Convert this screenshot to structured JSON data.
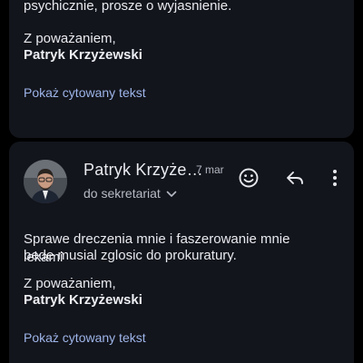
{
  "previous_message": {
    "body_fragment": "psychicznie, prosze o wyjasnienie.",
    "signoff": "Z poważaniem,",
    "signature": "Patryk Krzyżewski",
    "show_quoted_text": "Pokaż cytowany tekst"
  },
  "message": {
    "sender_name": "Patryk Krzyże…",
    "date": "7 mar",
    "recipient": "do sekretariat",
    "body_line_1": "Sprawe dreczenia mnie i faszerowanie mnie lekami",
    "body_line_2": "bede musial zglosic do prokuratury.",
    "signoff": "Z poważaniem,",
    "signature": "Patryk Krzyżewski",
    "show_quoted_text": "Pokaż cytowany tekst"
  },
  "icons": {
    "emoji": "smiley-icon",
    "reply": "reply-icon",
    "more": "more-vert-icon",
    "chevron": "chevron-down-icon"
  },
  "colors": {
    "background": "#000000",
    "card": "#13151c",
    "text": "#e8eaf0",
    "link": "#9db4e8",
    "secondary": "#b6bac4"
  }
}
